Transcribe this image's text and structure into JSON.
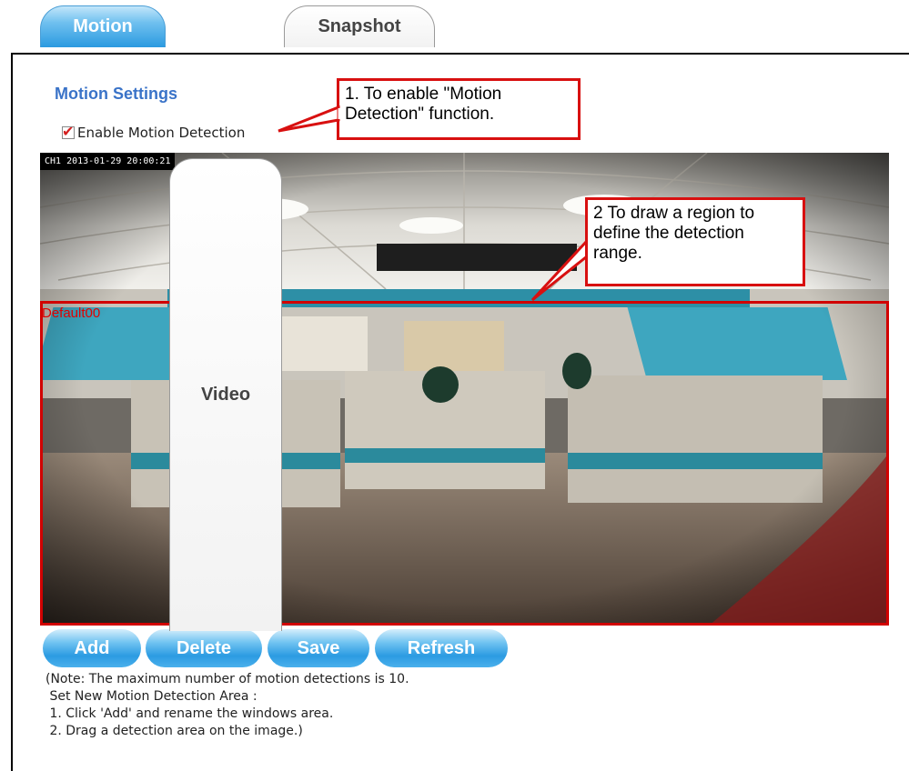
{
  "tabs": [
    {
      "label": "Motion",
      "active": true
    },
    {
      "label": "Video",
      "active": false
    },
    {
      "label": "Snapshot",
      "active": false
    }
  ],
  "section_title": "Motion Settings",
  "enable_checkbox": {
    "label": "Enable Motion Detection",
    "checked": true
  },
  "callouts": {
    "enable": "1. To enable \"Motion Detection\" function.",
    "draw": "2 To draw a region to define the detection range."
  },
  "video": {
    "osd": "CH1 2013-01-29 20:00:21"
  },
  "region": {
    "label": "Default00"
  },
  "buttons": {
    "add": "Add",
    "delete": "Delete",
    "save": "Save",
    "refresh": "Refresh"
  },
  "notes": [
    "(Note: The maximum number of motion detections is 10.",
    " Set New Motion Detection Area :",
    " 1. Click 'Add' and rename the windows area.",
    " 2. Drag a detection area on the image.)"
  ],
  "colors": {
    "accent": "#2c9be2",
    "region": "#d10000",
    "title": "#3a73c8"
  }
}
